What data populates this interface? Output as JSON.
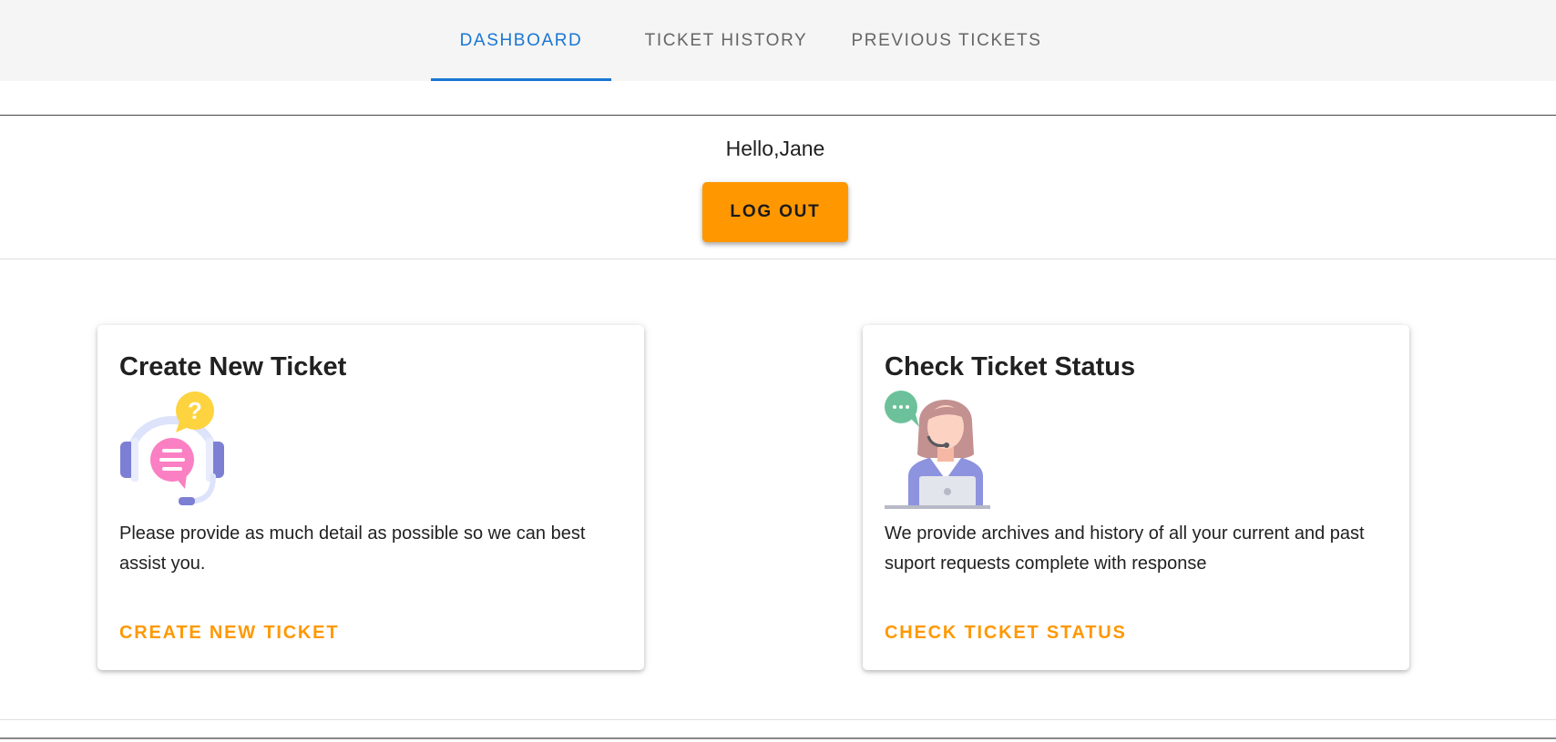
{
  "nav": {
    "tabs": [
      {
        "label": "DASHBOARD",
        "active": true
      },
      {
        "label": "TICKET HISTORY",
        "active": false
      },
      {
        "label": "PREVIOUS TICKETS",
        "active": false
      }
    ],
    "active_color": "#1976d2",
    "inactive_color": "#666666"
  },
  "user": {
    "greeting": "Hello,Jane",
    "logout_label": "LOG OUT"
  },
  "cards": [
    {
      "title": "Create New Ticket",
      "icon": "support-headset-icon",
      "description": "Please provide as much detail as possible so we can best assist you.",
      "action_label": "CREATE NEW TICKET"
    },
    {
      "title": "Check Ticket Status",
      "icon": "support-agent-icon",
      "description": "We provide archives and history of all your current and past suport requests complete with response",
      "action_label": "CHECK TICKET STATUS"
    }
  ],
  "colors": {
    "accent": "#ff9800",
    "primary": "#1976d2",
    "topbar_bg": "#f5f5f5"
  }
}
